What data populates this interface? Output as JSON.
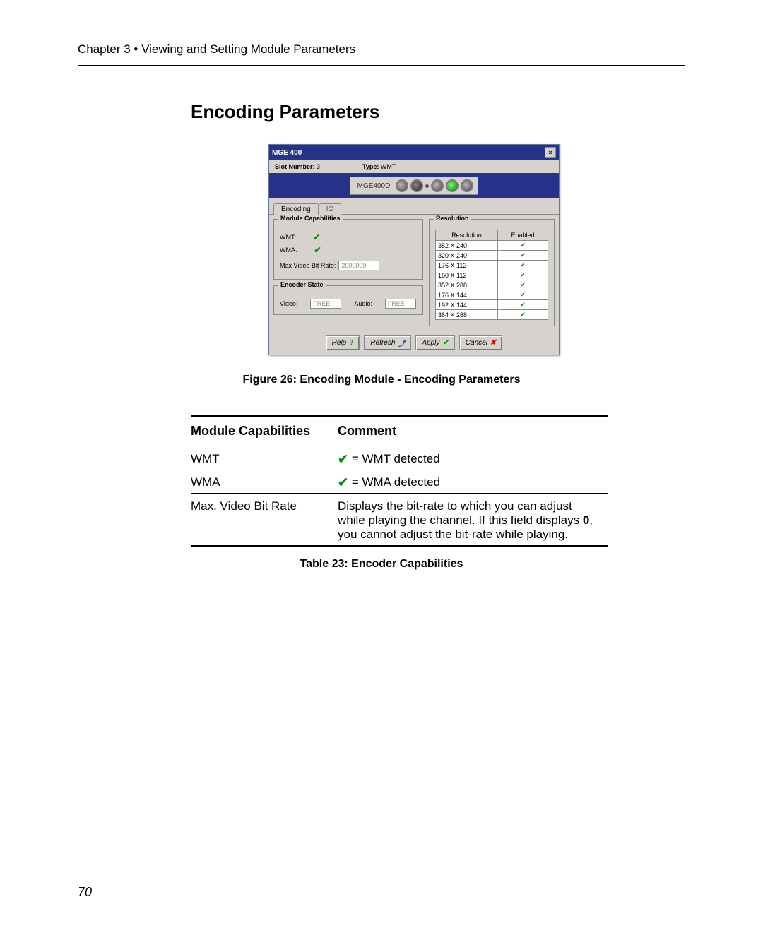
{
  "header": {
    "chapter": "Chapter 3",
    "sep": "•",
    "title": "Viewing and Setting Module Parameters"
  },
  "section_title": "Encoding Parameters",
  "dialog": {
    "title": "MGE 400",
    "close": "×",
    "slot_label": "Slot Number:",
    "slot_value": "3",
    "type_label": "Type:",
    "type_value": "WMT",
    "device": "MGE400D",
    "tabs": [
      "Encoding",
      "IO"
    ],
    "caps": {
      "group": "Module Capabilities",
      "wmt": "WMT:",
      "wma": "WMA:",
      "rate_label": "Max Video Bit Rate:",
      "rate_value": "2000000"
    },
    "state": {
      "group": "Encoder State",
      "video_label": "Video:",
      "video_value": "FREE",
      "audio_label": "Audio:",
      "audio_value": "FREE"
    },
    "res": {
      "group": "Resolution",
      "col1": "Resolution",
      "col2": "Enabled",
      "rows": [
        "352 X 240",
        "320 X 240",
        "176 X 112",
        "160 X 112",
        "352 X 288",
        "176 X 144",
        "192 X 144",
        "384 X 288"
      ]
    },
    "buttons": {
      "help": "Help",
      "refresh": "Refresh",
      "apply": "Apply",
      "cancel": "Cancel"
    }
  },
  "figure_caption": "Figure 26: Encoding Module - Encoding Parameters",
  "table": {
    "h1": "Module Capabilities",
    "h2": "Comment",
    "r1c1": "WMT",
    "r1c2": " = WMT detected",
    "r2c1": "WMA",
    "r2c2": " = WMA detected",
    "r3c1": "Max. Video Bit Rate",
    "r3c2a": "Displays the bit-rate to which you can adjust while playing the channel. If this field displays ",
    "r3c2b": "0",
    "r3c2c": ", you cannot adjust the bit-rate while playing."
  },
  "table_caption": "Table 23: Encoder Capabilities",
  "page_number": "70"
}
